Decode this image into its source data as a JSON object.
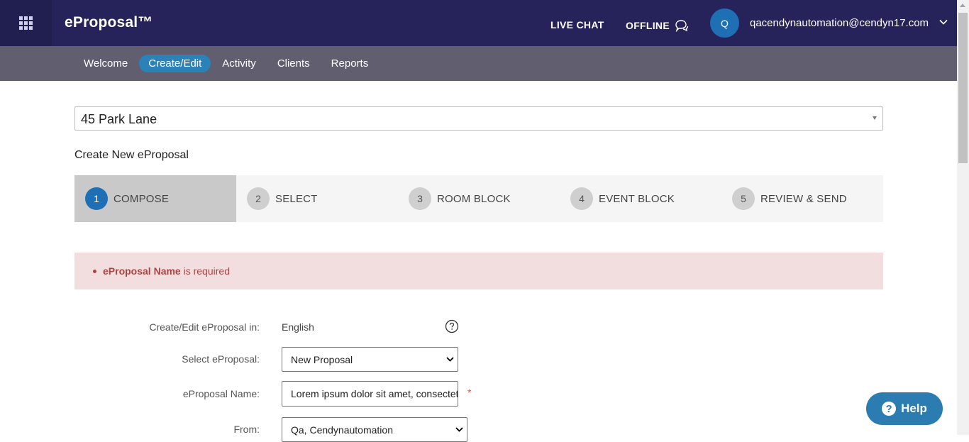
{
  "header": {
    "brand": "eProposal™",
    "live_chat": "LIVE CHAT",
    "offline": "OFFLINE",
    "avatar_initial": "Q",
    "user_email": "qacendynautomation@cendyn17.com"
  },
  "nav": {
    "items": [
      {
        "label": "Welcome",
        "active": false
      },
      {
        "label": "Create/Edit",
        "active": true
      },
      {
        "label": "Activity",
        "active": false
      },
      {
        "label": "Clients",
        "active": false
      },
      {
        "label": "Reports",
        "active": false
      }
    ]
  },
  "property_select": {
    "value": "45 Park Lane"
  },
  "page_title": "Create New eProposal",
  "steps": [
    {
      "number": "1",
      "label": "COMPOSE",
      "active": true
    },
    {
      "number": "2",
      "label": "SELECT",
      "active": false
    },
    {
      "number": "3",
      "label": "ROOM BLOCK",
      "active": false
    },
    {
      "number": "4",
      "label": "EVENT BLOCK",
      "active": false
    },
    {
      "number": "5",
      "label": "REVIEW & SEND",
      "active": false
    }
  ],
  "alert": {
    "field": "eProposal Name",
    "message": " is required"
  },
  "form": {
    "language_label": "Create/Edit eProposal in:",
    "language_value": "English",
    "select_label": "Select eProposal:",
    "select_value": "New Proposal",
    "name_label": "eProposal Name:",
    "name_value": "Lorem ipsum dolor sit amet, consectetur",
    "name_required_mark": "*",
    "from_label": "From:",
    "from_value": "Qa, Cendynautomation"
  },
  "help_button": {
    "label": "Help",
    "icon": "?"
  },
  "colors": {
    "topbar": "#26235a",
    "navbar": "#615e70",
    "accent": "#1f6fb5",
    "alert_bg": "#f2dede",
    "alert_text": "#a94442"
  }
}
